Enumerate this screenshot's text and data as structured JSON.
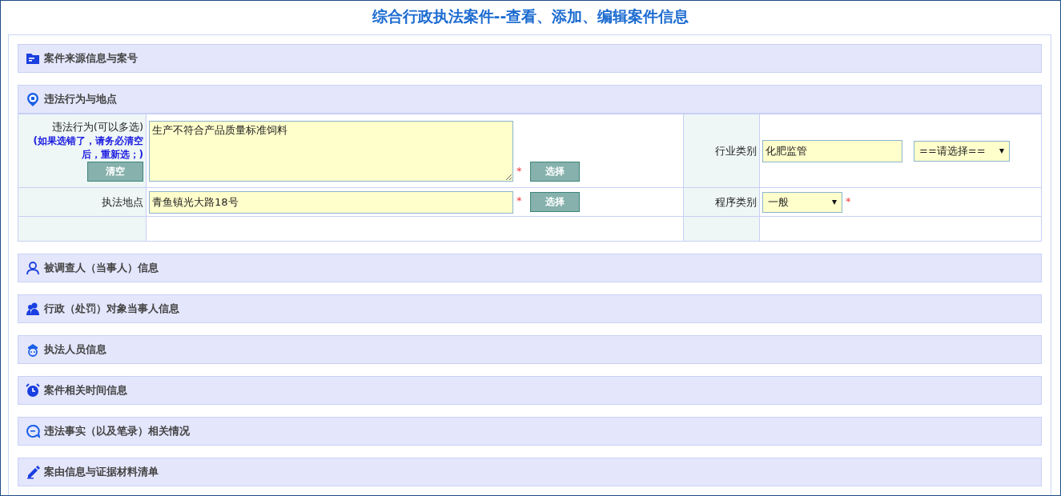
{
  "page_title": "综合行政执法案件--查看、添加、编辑案件信息",
  "sections": [
    {
      "title": "案件来源信息与案号"
    },
    {
      "title": "违法行为与地点",
      "form": {
        "rows": [
          {
            "left": {
              "label": "违法行为(可以多选)",
              "hint": "(如果选错了，请务必清空后，重新选；)",
              "clear_button": "清空",
              "kind": "textarea",
              "value": "生产不符合产品质量标准饲料",
              "mark": "*",
              "pick_button": "选择"
            },
            "right": {
              "label": "行业类别",
              "kind": "input-select",
              "value": "化肥监管",
              "select": "==请选择=="
            }
          },
          {
            "left": {
              "label": "执法地点",
              "kind": "input",
              "value": "青鱼镇光大路18号",
              "mark": "*",
              "pick_button": "选择"
            },
            "right": {
              "label": "程序类别",
              "kind": "select",
              "select": "一般",
              "mark": "*"
            }
          },
          {
            "left": {
              "kind": "empty"
            },
            "right": {
              "kind": "empty"
            }
          }
        ]
      }
    },
    {
      "title": "被调查人（当事人）信息"
    },
    {
      "title": "行政（处罚）对象当事人信息"
    },
    {
      "title": "执法人员信息"
    },
    {
      "title": "案件相关时间信息"
    },
    {
      "title": "违法事实（以及笔录）相关情况"
    },
    {
      "title": "案由信息与证据材料清单"
    }
  ]
}
